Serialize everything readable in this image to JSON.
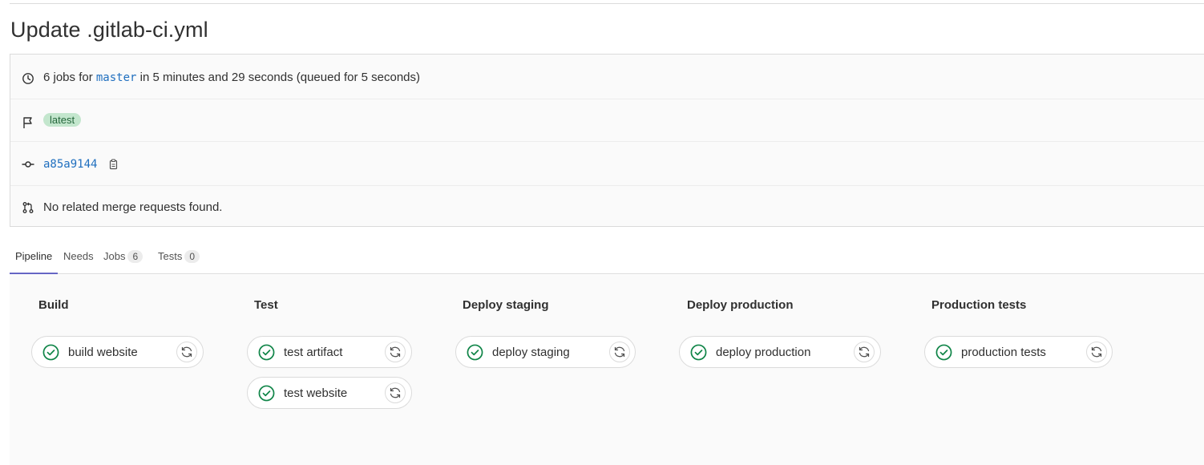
{
  "header": {
    "title": "Update .gitlab-ci.yml"
  },
  "info": {
    "jobs_count_text": "6 jobs for",
    "branch": "master",
    "duration_text": "in 5 minutes and 29 seconds (queued for 5 seconds)",
    "badge": "latest",
    "commit_sha": "a85a9144",
    "merge_requests_text": "No related merge requests found."
  },
  "tabs": [
    {
      "label": "Pipeline",
      "active": true
    },
    {
      "label": "Needs"
    },
    {
      "label": "Jobs",
      "count": "6"
    },
    {
      "label": "Tests",
      "count": "0"
    }
  ],
  "stages": [
    {
      "title": "Build",
      "jobs": [
        {
          "name": "build website",
          "status": "passed"
        }
      ]
    },
    {
      "title": "Test",
      "jobs": [
        {
          "name": "test artifact",
          "status": "passed"
        },
        {
          "name": "test website",
          "status": "passed"
        }
      ]
    },
    {
      "title": "Deploy staging",
      "jobs": [
        {
          "name": "deploy staging",
          "status": "passed"
        }
      ]
    },
    {
      "title": "Deploy production",
      "jobs": [
        {
          "name": "deploy production",
          "status": "passed"
        }
      ]
    },
    {
      "title": "Production tests",
      "jobs": [
        {
          "name": "production tests",
          "status": "passed"
        }
      ]
    }
  ],
  "icons": {
    "duration": "clock-icon",
    "flag": "flag-icon",
    "commit": "commit-icon",
    "copy": "copy-icon",
    "merge_request": "merge-request-icon",
    "job_status": "status-success-icon",
    "job_action": "retry-icon"
  },
  "colors": {
    "success": "#108548",
    "link": "#1f6fbf",
    "badge_bg": "#c3e6cd",
    "badge_text": "#24663b",
    "tab_active": "#6666c4"
  }
}
